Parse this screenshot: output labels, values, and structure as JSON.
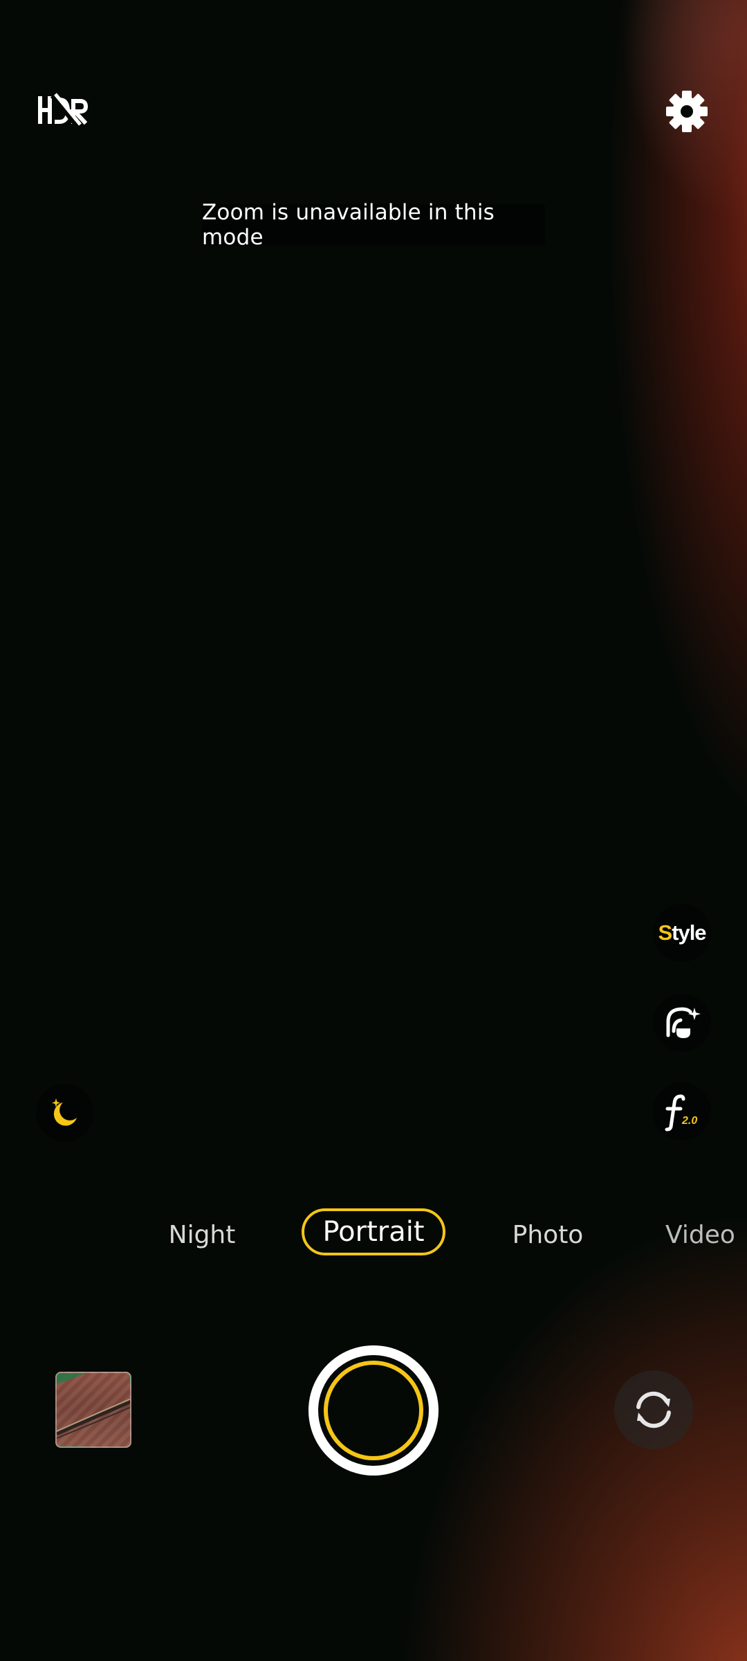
{
  "toast": {
    "text": "Zoom is unavailable in this mode"
  },
  "side_controls": {
    "style_label_first": "S",
    "style_label_rest": "tyle",
    "aperture_value": "2.0"
  },
  "modes": {
    "items": [
      {
        "label": "Night",
        "selected": false
      },
      {
        "label": "Portrait",
        "selected": true
      },
      {
        "label": "Photo",
        "selected": false
      },
      {
        "label": "Video",
        "selected": false
      }
    ]
  },
  "icons": {
    "hdr": "hdr-off-icon",
    "settings": "gear-icon",
    "beauty": "face-retouch-icon",
    "aperture": "aperture-f-icon",
    "night": "moon-sparkle-icon",
    "switch": "switch-camera-icon"
  },
  "colors": {
    "accent": "#f5c518",
    "background": "#040906",
    "text": "#ffffff"
  }
}
